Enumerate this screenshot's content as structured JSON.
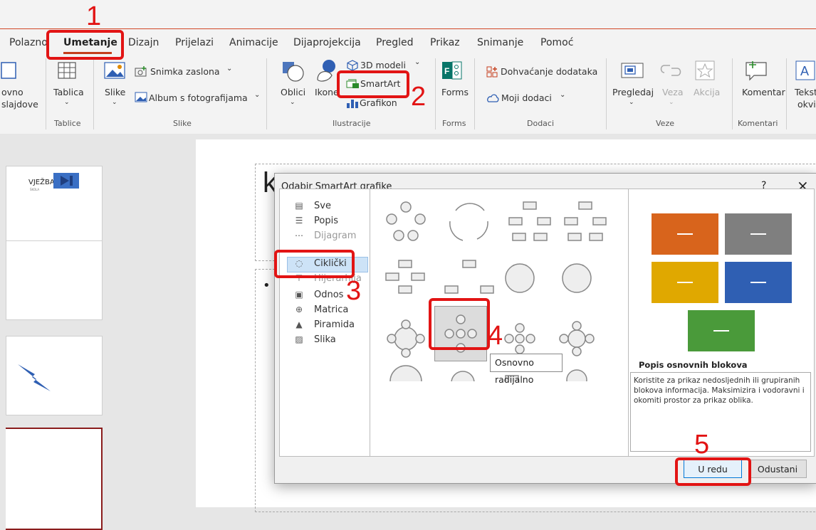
{
  "ribbon": {
    "tabs": [
      "Polazno",
      "Umetanje",
      "Dizajn",
      "Prijelazi",
      "Animacije",
      "Dijaprojekcija",
      "Pregled",
      "Prikaz",
      "Snimanje",
      "Pomoć"
    ],
    "active_tab": "Umetanje",
    "commands": {
      "novo_slajdove": "ovno",
      "novo_slajdove2": "slajdove",
      "tablica": "Tablica",
      "slike": "Slike",
      "snimka_zaslona": "Snimka zaslona",
      "album": "Album s fotografijama",
      "oblici": "Oblici",
      "ikone": "Ikone",
      "modeli_3d": "3D modeli",
      "smartart": "SmartArt",
      "grafikon": "Grafikon",
      "forms": "Forms",
      "dohvacanje": "Dohvaćanje dodataka",
      "moji_dodaci": "Moji dodaci",
      "pregledaj": "Pregledaj",
      "veza": "Veza",
      "akcija": "Akcija",
      "komentar": "Komentar",
      "tekstni": "Teksti",
      "okvir": "okvi"
    },
    "groups": [
      "Tablice",
      "Slike",
      "Ilustracije",
      "Forms",
      "Dodaci",
      "Veze",
      "Komentari"
    ]
  },
  "annotations": [
    "1",
    "2",
    "3",
    "4",
    "5"
  ],
  "slides": {
    "thumb1_text": "VJEŽBA",
    "thumb1_sub": "ŠKOLA"
  },
  "slide_title_fragment": "k",
  "dialog": {
    "title": "Odabir SmartArt grafike",
    "help": "?",
    "close": "×",
    "categories": [
      "Sve",
      "Popis",
      "Dijagram",
      "Ciklički",
      "Hijerarhija",
      "Odnos",
      "Matrica",
      "Piramida",
      "Slika"
    ],
    "selected_category": "Ciklički",
    "tooltip": "Osnovno radijalno",
    "preview_title": "Popis osnovnih blokova",
    "preview_desc": "Koristite za prikaz nedosljednih ili grupiranih blokova informacija. Maksimizira i vodoravni i okomiti prostor za prikaz oblika.",
    "ok": "U redu",
    "cancel": "Odustani",
    "preview_colors": [
      "#d8641c",
      "#7f7f7f",
      "#e0a800",
      "#2f5fb3",
      "#4a9a3a"
    ]
  }
}
